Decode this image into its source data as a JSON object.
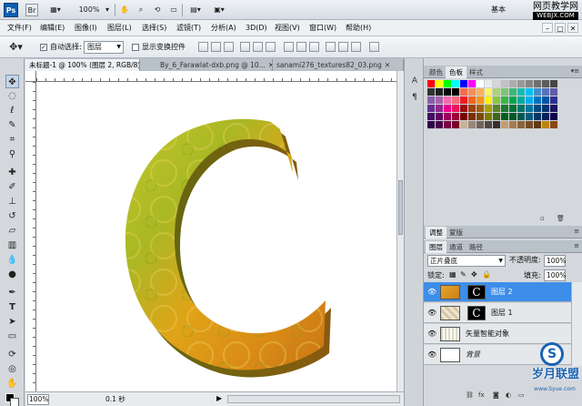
{
  "titlebar": {
    "app_logo": "Ps",
    "bridge_label": "Br",
    "zoom": "100%",
    "workspace": "基本",
    "watermark_cn": "网页教学网",
    "watermark_url": "WEBJX.COM"
  },
  "menu": {
    "items": [
      "文件(F)",
      "编辑(E)",
      "图像(I)",
      "图层(L)",
      "选择(S)",
      "滤镜(T)",
      "分析(A)",
      "3D(D)",
      "视图(V)",
      "窗口(W)",
      "帮助(H)"
    ]
  },
  "options": {
    "auto_select_label": "自动选择:",
    "auto_select_checked": true,
    "auto_select_value": "图层",
    "transform_controls_label": "显示变换控件",
    "transform_controls_checked": false
  },
  "tabs": [
    {
      "label": "未标题-1 @ 100% (图层 2, RGB/8) *",
      "active": true
    },
    {
      "label": "By_6_Farawlat-dxb.png @ 10...",
      "active": false
    },
    {
      "label": "sanami276_textures82_03.png",
      "active": false
    }
  ],
  "canvas": {
    "letter": "C"
  },
  "status": {
    "zoom": "100%",
    "time": "0.1 秒"
  },
  "panels": {
    "swatch_tabs": [
      "颜色",
      "色板",
      "样式"
    ],
    "adjust_tabs": [
      "调整",
      "蒙版"
    ],
    "layer_tabs": [
      "图层",
      "通道",
      "路径"
    ]
  },
  "swatch_colors": [
    [
      "#ff0000",
      "#ffff00",
      "#00ff00",
      "#00ffff",
      "#0000ff",
      "#ff00ff",
      "#ffffff",
      "#ebebeb",
      "#d6d6d6",
      "#c2c2c2",
      "#adadad",
      "#999999",
      "#858585",
      "#707070",
      "#5c5c5c",
      "#474747"
    ],
    [
      "#333333",
      "#1f1f1f",
      "#0a0a0a",
      "#000000",
      "#f26c4f",
      "#f68e56",
      "#fbaf5d",
      "#fff467",
      "#acd372",
      "#7cc576",
      "#3bb878",
      "#1abbb4",
      "#00bff3",
      "#438ccb",
      "#5574b9",
      "#605ca8"
    ],
    [
      "#855fa8",
      "#a763a8",
      "#f06eaa",
      "#f26d7d",
      "#ed1c24",
      "#f26522",
      "#f7941d",
      "#fff200",
      "#8dc63f",
      "#39b54a",
      "#00a651",
      "#00a99d",
      "#00aeef",
      "#0072bc",
      "#0054a6",
      "#2e3192"
    ],
    [
      "#662d91",
      "#92278f",
      "#ec008c",
      "#ed145b",
      "#9e0b0f",
      "#a0410d",
      "#a3620a",
      "#aba000",
      "#598527",
      "#1a7b30",
      "#007236",
      "#00746b",
      "#0076a3",
      "#004b80",
      "#003471",
      "#1b1464"
    ],
    [
      "#440e62",
      "#630460",
      "#9e005d",
      "#9e0039",
      "#790000",
      "#7b2e00",
      "#7d4900",
      "#827b00",
      "#406618",
      "#005e20",
      "#005826",
      "#005952",
      "#005b7f",
      "#003663",
      "#002157",
      "#0d004c"
    ],
    [
      "#32004b",
      "#4b0049",
      "#7b0046",
      "#7a0026",
      "#c7b299",
      "#998675",
      "#736357",
      "#534741",
      "#37302a",
      "#c69c6d",
      "#a67c52",
      "#8c6239",
      "#754c24",
      "#603913",
      "#b8860b",
      "#8b4513"
    ]
  ],
  "layers": {
    "blend_mode": "正片叠底",
    "opacity_label": "不透明度:",
    "opacity": "100%",
    "lock_label": "锁定:",
    "fill_label": "填充:",
    "fill": "100%",
    "items": [
      {
        "name": "图层 2",
        "selected": true
      },
      {
        "name": "图层 1",
        "selected": false
      },
      {
        "name": "矢量智能对象",
        "selected": false
      },
      {
        "name": "背景",
        "selected": false
      }
    ]
  },
  "watermark_bottom": {
    "logo": "S",
    "text": "岁月联盟",
    "url": "www.Syue.com"
  }
}
